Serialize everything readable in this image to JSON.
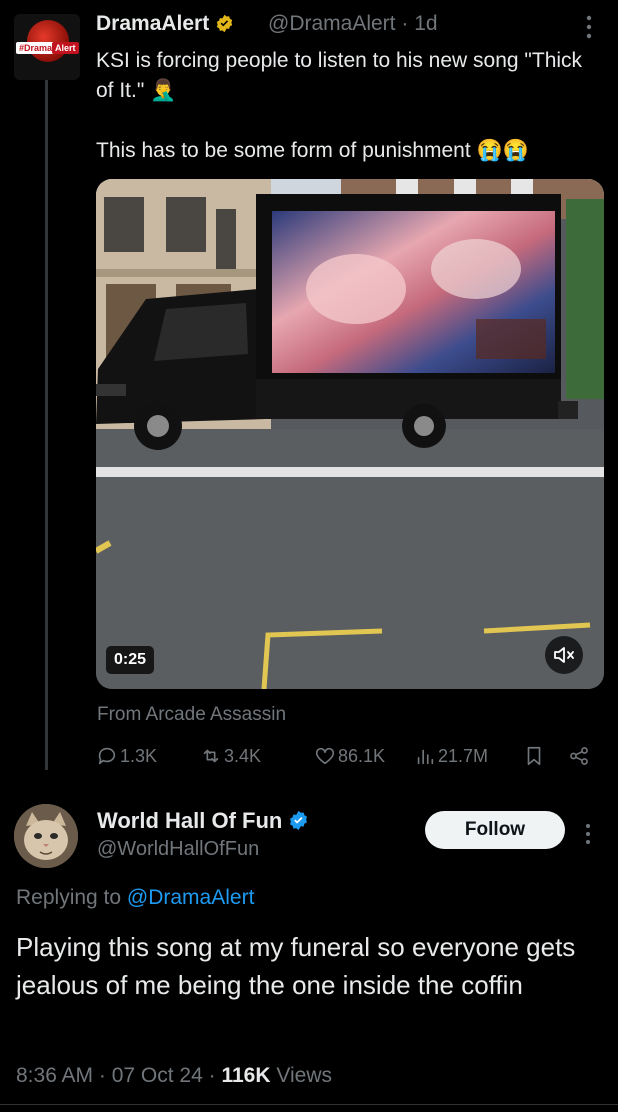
{
  "tweet": {
    "author_name": "DramaAlert",
    "author_handle": "@DramaAlert",
    "time_ago": "1d",
    "avatar_tag_left": "#Drama",
    "avatar_tag_right": "Alert",
    "text": "KSI is forcing people to listen to his new song \"Thick of It.\" 🤦‍♂️\n\nThis has to be some form of punishment 😭😭",
    "video_duration": "0:25",
    "source": "From Arcade Assassin",
    "replies": "1.3K",
    "reposts": "3.4K",
    "likes": "86.1K",
    "views": "21.7M"
  },
  "reply": {
    "author_name": "World Hall Of Fun",
    "author_handle": "@WorldHallOfFun",
    "follow_label": "Follow",
    "replying_prefix": "Replying to",
    "replying_to": "@DramaAlert",
    "text": "Playing this song at my funeral so everyone gets jealous of me being the one inside the coffin",
    "time": "8:36 AM",
    "date": "07 Oct 24",
    "views_count": "116K",
    "views_label": "Views"
  },
  "colors": {
    "background": "#000000",
    "text": "#e7e9ea",
    "muted": "#71767b",
    "accent": "#1d9bf0"
  },
  "icons": [
    "more-icon",
    "verified-icon",
    "reply-icon",
    "repost-icon",
    "like-icon",
    "views-icon",
    "bookmark-icon",
    "share-icon",
    "mute-icon"
  ]
}
